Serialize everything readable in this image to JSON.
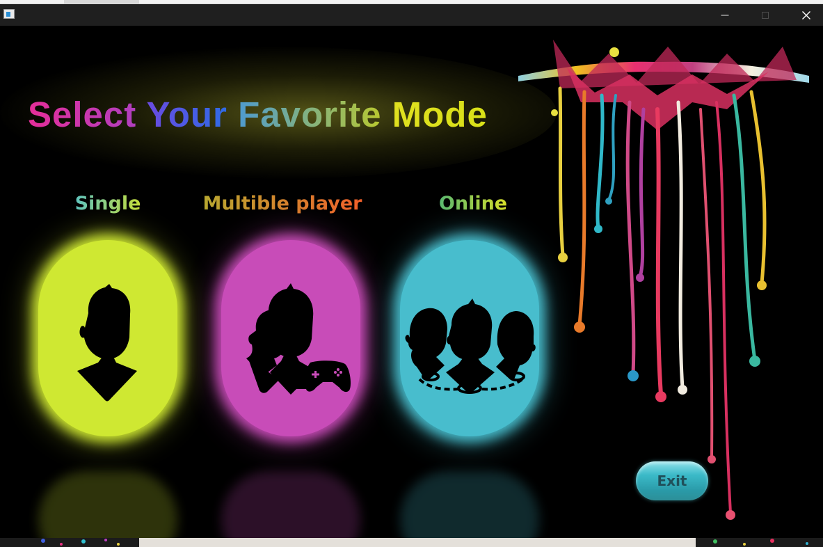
{
  "window": {
    "controls": {
      "minimize": "minimize",
      "maximize": "maximize",
      "close": "✕"
    }
  },
  "title": {
    "words": [
      {
        "text": "Select",
        "gradient": [
          "#e52e99",
          "#b03fbf"
        ]
      },
      {
        "text": "Your",
        "gradient": [
          "#6a4be0",
          "#2f6be6"
        ]
      },
      {
        "text": "Favorite",
        "gradient": [
          "#4e9bd0",
          "#b8c830"
        ]
      },
      {
        "text": "Mode",
        "gradient": [
          "#e0e020",
          "#d8e018"
        ]
      }
    ]
  },
  "modes": [
    {
      "label": "Single",
      "label_gradient": [
        "#5fc4c0",
        "#c5dd3a"
      ],
      "card_color": "#cfe832",
      "icon": "single-player-icon"
    },
    {
      "label": "Multible player",
      "label_gradient": [
        "#b8a830",
        "#f0602a"
      ],
      "card_color": "#c84cb8",
      "icon": "multiplayer-gamepad-icon"
    },
    {
      "label": "Online",
      "label_gradient": [
        "#5ab870",
        "#d8e02a"
      ],
      "card_color": "#48bdcd",
      "icon": "online-group-icon"
    }
  ],
  "exit_button": {
    "label": "Exit",
    "color": "#3bbac8"
  },
  "colors": {
    "background": "#000000",
    "titlebar": "#1f1f1f"
  }
}
